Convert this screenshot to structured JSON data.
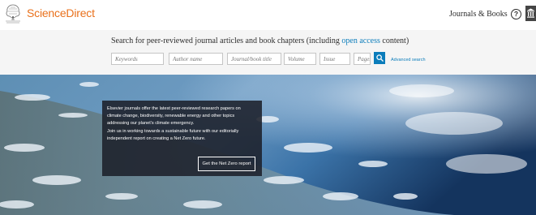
{
  "header": {
    "brand": "ScienceDirect",
    "nav_journals": "Journals & Books",
    "help_glyph": "?",
    "brand_color": "#e9711c",
    "icons": [
      "elsevier-tree-logo",
      "help-icon",
      "institution-icon"
    ]
  },
  "search": {
    "intro_before": "Search for peer-reviewed journal articles and book chapters (including ",
    "intro_link": "open access",
    "intro_after": " content)",
    "placeholders": {
      "keywords": "Keywords",
      "author": "Author name",
      "journal": "Journal/book title",
      "volume": "Volume",
      "issue": "Issue",
      "pages": "Pages"
    },
    "advanced_link": "Advanced search",
    "accent_color": "#0c7dbb",
    "button_icon": "search-icon"
  },
  "hero": {
    "lines": [
      "Elsevier journals offer the latest peer-reviewed research papers on",
      "climate change, biodiversity, renewable energy and other topics",
      "addressing our planet's climate emergency.",
      "Join us in working towards a sustainable future with our editorially",
      "independent report on creating a Net Zero future."
    ],
    "button_label": "Get the Net Zero report"
  }
}
